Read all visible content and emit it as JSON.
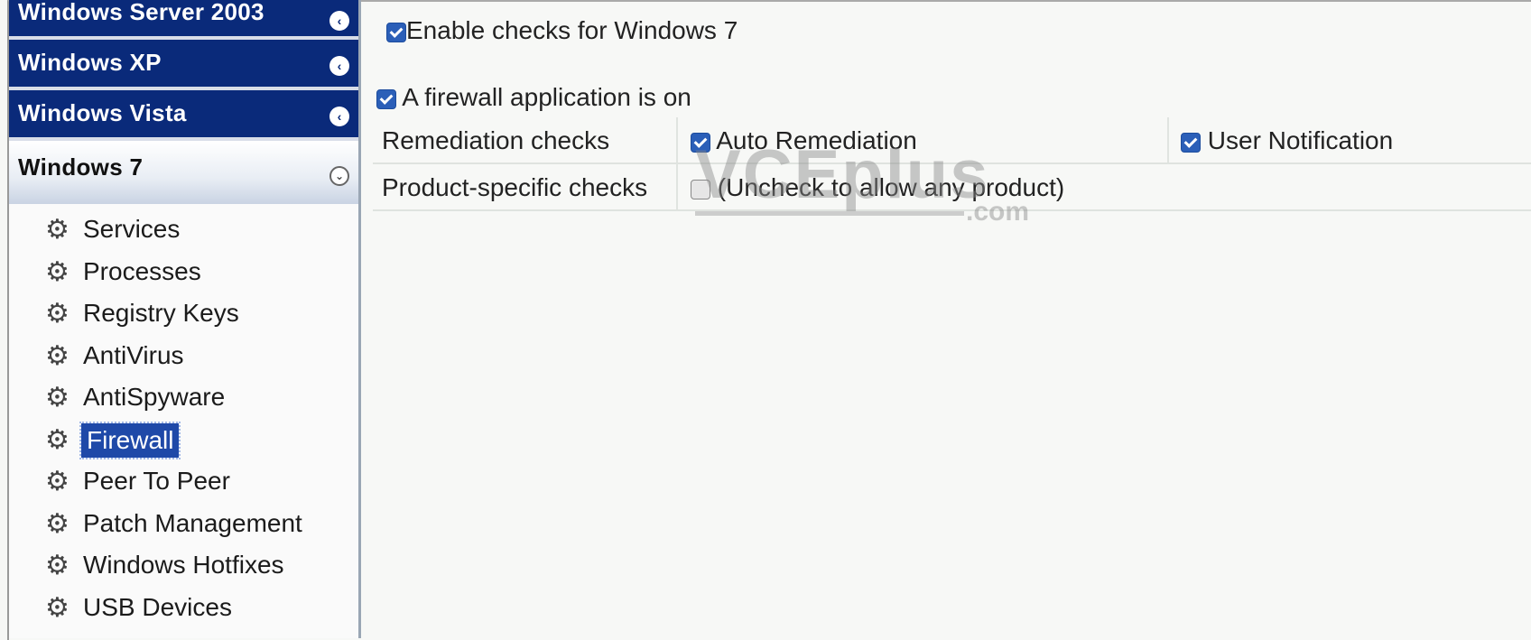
{
  "sidebar": {
    "os_headers": [
      {
        "label": "Windows Server 2003"
      },
      {
        "label": "Windows XP"
      },
      {
        "label": "Windows Vista"
      },
      {
        "label": "Windows 7"
      }
    ],
    "items": [
      {
        "label": "Services",
        "icon": "gear-icon"
      },
      {
        "label": "Processes",
        "icon": "gear-icon"
      },
      {
        "label": "Registry Keys",
        "icon": "gear-icon"
      },
      {
        "label": "AntiVirus",
        "icon": "gear-icon"
      },
      {
        "label": "AntiSpyware",
        "icon": "gear-icon"
      },
      {
        "label": "Firewall",
        "icon": "gear-icon",
        "selected": true
      },
      {
        "label": "Peer To Peer",
        "icon": "gear-icon"
      },
      {
        "label": "Patch Management",
        "icon": "gear-icon"
      },
      {
        "label": "Windows Hotfixes",
        "icon": "gear-icon"
      },
      {
        "label": "USB Devices",
        "icon": "gear-icon"
      }
    ]
  },
  "main": {
    "enable_checks": {
      "label": "Enable checks for Windows 7",
      "checked": true
    },
    "firewall_on": {
      "label": "A firewall application is on",
      "checked": true
    },
    "remediation": {
      "label": "Remediation checks",
      "auto_remediation": {
        "label": "Auto Remediation",
        "checked": true
      },
      "user_notification": {
        "label": "User Notification",
        "checked": true
      }
    },
    "product_specific": {
      "label": "Product-specific checks",
      "uncheck_any": {
        "label": "(Uncheck to allow any product)",
        "checked": false
      }
    }
  },
  "watermark": {
    "text": "VCEplus",
    "suffix": ".com"
  },
  "colors": {
    "header_blue": "#0a2a7a",
    "checkbox_blue": "#2b5fb8",
    "selected_bg": "#1f49a8"
  }
}
